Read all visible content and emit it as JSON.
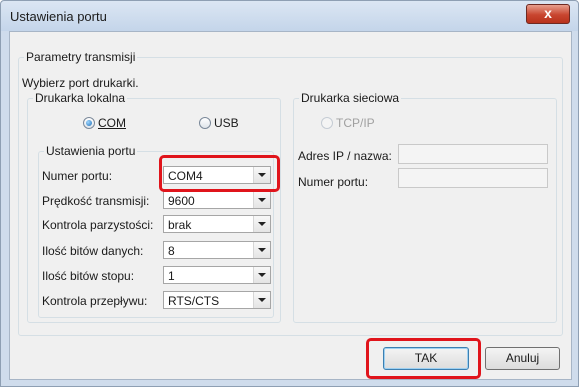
{
  "window": {
    "title": "Ustawienia portu",
    "close_glyph": "x"
  },
  "transmission_group": {
    "legend": "Parametry transmisji",
    "instruction": "Wybierz port drukarki."
  },
  "local_printer": {
    "legend": "Drukarka lokalna",
    "com_label": "COM",
    "usb_label": "USB",
    "selected": "COM"
  },
  "port_settings": {
    "legend": "Ustawienia portu",
    "fields": [
      {
        "label": "Numer portu:",
        "value": "COM4"
      },
      {
        "label": "Prędkość transmisji:",
        "value": "9600"
      },
      {
        "label": "Kontrola parzystości:",
        "value": "brak"
      },
      {
        "label": "Ilość bitów danych:",
        "value": "8"
      },
      {
        "label": "Ilość bitów stopu:",
        "value": "1"
      },
      {
        "label": "Kontrola przepływu:",
        "value": "RTS/CTS"
      }
    ]
  },
  "network_printer": {
    "legend": "Drukarka sieciowa",
    "tcpip_label": "TCP/IP",
    "ip_label": "Adres IP / nazwa:",
    "ip_value": "",
    "port_label": "Numer portu:",
    "port_value": ""
  },
  "buttons": {
    "ok_label": "TAK",
    "cancel_label": "Anuluj"
  },
  "colors": {
    "highlight": "#e0141b",
    "close_button": "#c8452f",
    "dialog_bg": "#f0f0f0"
  },
  "icons": {
    "close": "close-icon",
    "dropdown": "chevron-down-icon"
  }
}
